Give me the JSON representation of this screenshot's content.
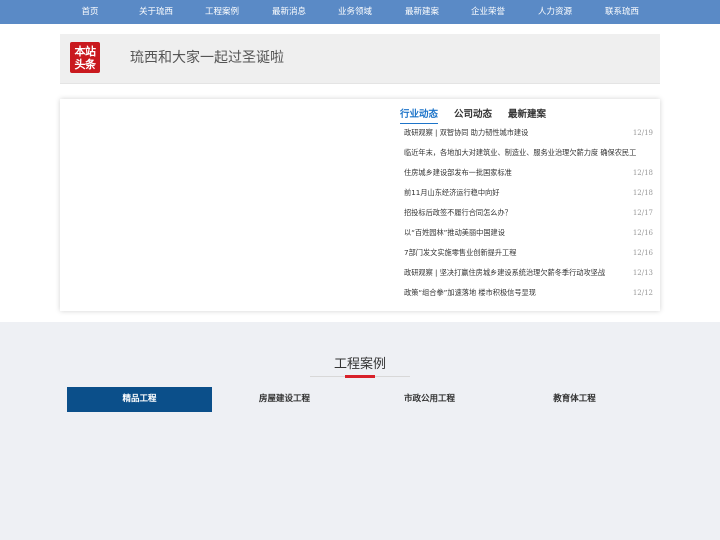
{
  "nav": {
    "items": [
      "首页",
      "关于琉西",
      "工程案例",
      "最新消息",
      "业务领域",
      "最新建案",
      "企业荣誉",
      "人力资源",
      "联系琉西"
    ]
  },
  "headline": {
    "badge_line1": "本站",
    "badge_line2": "头条",
    "text": "琉西和大家一起过圣诞啦"
  },
  "news": {
    "tabs": [
      "行业动态",
      "公司动态",
      "最新建案"
    ],
    "items": [
      {
        "title": "政研观察 | 双智协同 助力韧性城市建设",
        "date": "12/19"
      },
      {
        "title": "临近年末，各地加大对建筑业、制造业、服务业治理欠薪力度 确保农民工工资",
        "date": ""
      },
      {
        "title": "住房城乡建设部发布一批国家标准",
        "date": "12/18"
      },
      {
        "title": "前11月山东经济运行稳中向好",
        "date": "12/18"
      },
      {
        "title": "招投标后政签不履行合同怎么办？",
        "date": "12/17"
      },
      {
        "title": "以“百姓园林”推动美丽中国建设",
        "date": "12/16"
      },
      {
        "title": "7部门发文实施零售业创新提升工程",
        "date": "12/16"
      },
      {
        "title": "政研观察 | 坚决打赢住房城乡建设系统治理欠薪冬季行动攻坚战",
        "date": "12/13"
      },
      {
        "title": "政策“组合拳”加速落地 楼市积极信号显现",
        "date": "12/12"
      }
    ]
  },
  "cases": {
    "title": "工程案例",
    "tabs": [
      "精品工程",
      "房屋建设工程",
      "市政公用工程",
      "教育体工程"
    ]
  },
  "colors": {
    "nav_bg": "#5a8ac6",
    "badge_red": "#c9191e",
    "active_tab_blue": "#1d74c9",
    "category_active": "#0b4f8a",
    "accent_red": "#d8212a"
  }
}
